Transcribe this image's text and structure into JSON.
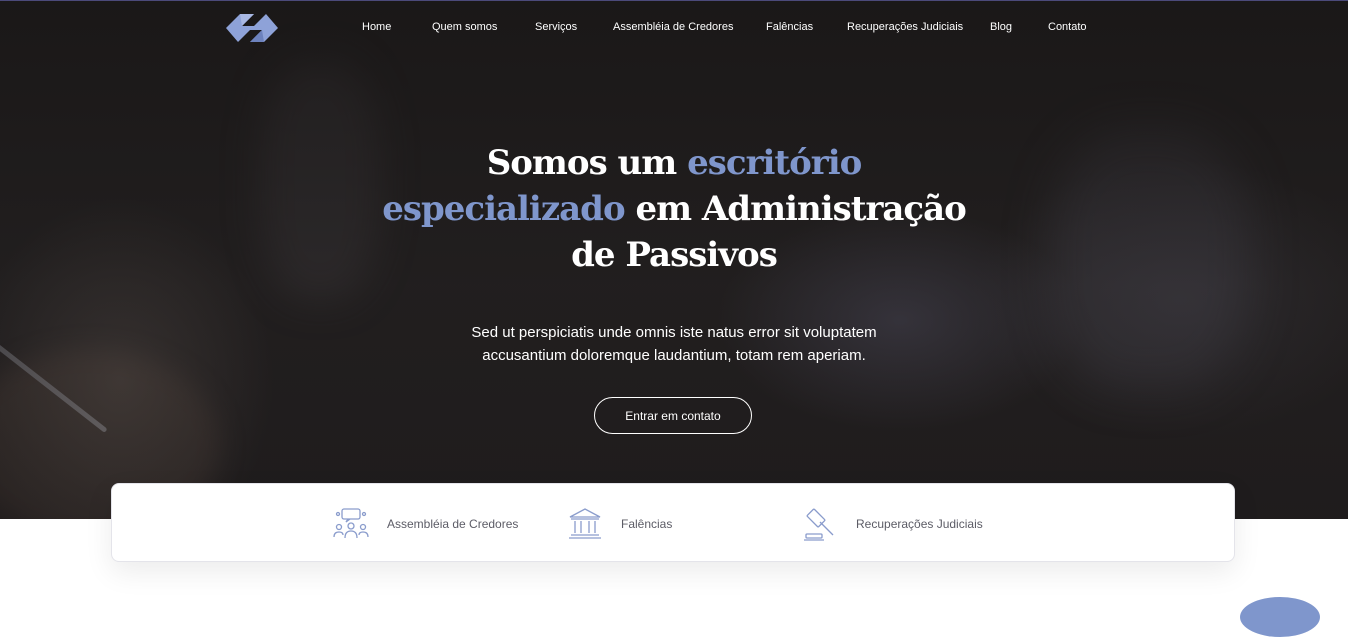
{
  "nav": {
    "items": [
      {
        "label": "Home"
      },
      {
        "label": "Quem somos"
      },
      {
        "label": "Serviços"
      },
      {
        "label": "Assembléia de Credores"
      },
      {
        "label": "Falências"
      },
      {
        "label": "Recuperações Judiciais"
      },
      {
        "label": "Blog"
      },
      {
        "label": "Contato"
      }
    ]
  },
  "hero": {
    "headline_part1": "Somos um ",
    "headline_accent1": "escritório especializado",
    "headline_part2": " em Administração de Passivos",
    "subtitle_line1": "Sed ut perspiciatis unde omnis iste natus error sit voluptatem",
    "subtitle_line2": "accusantium doloremque laudantium, totam rem aperiam.",
    "cta_label": "Entrar em contato"
  },
  "features": [
    {
      "label": "Assembléia de Credores",
      "icon": "group-meeting-icon"
    },
    {
      "label": "Falências",
      "icon": "bank-building-icon"
    },
    {
      "label": "Recuperações Judiciais",
      "icon": "gavel-icon"
    }
  ],
  "colors": {
    "accent": "#7f96cc",
    "hero_bg": "#221f1f",
    "text_light": "#ffffff",
    "feature_text": "#5c5c66"
  }
}
